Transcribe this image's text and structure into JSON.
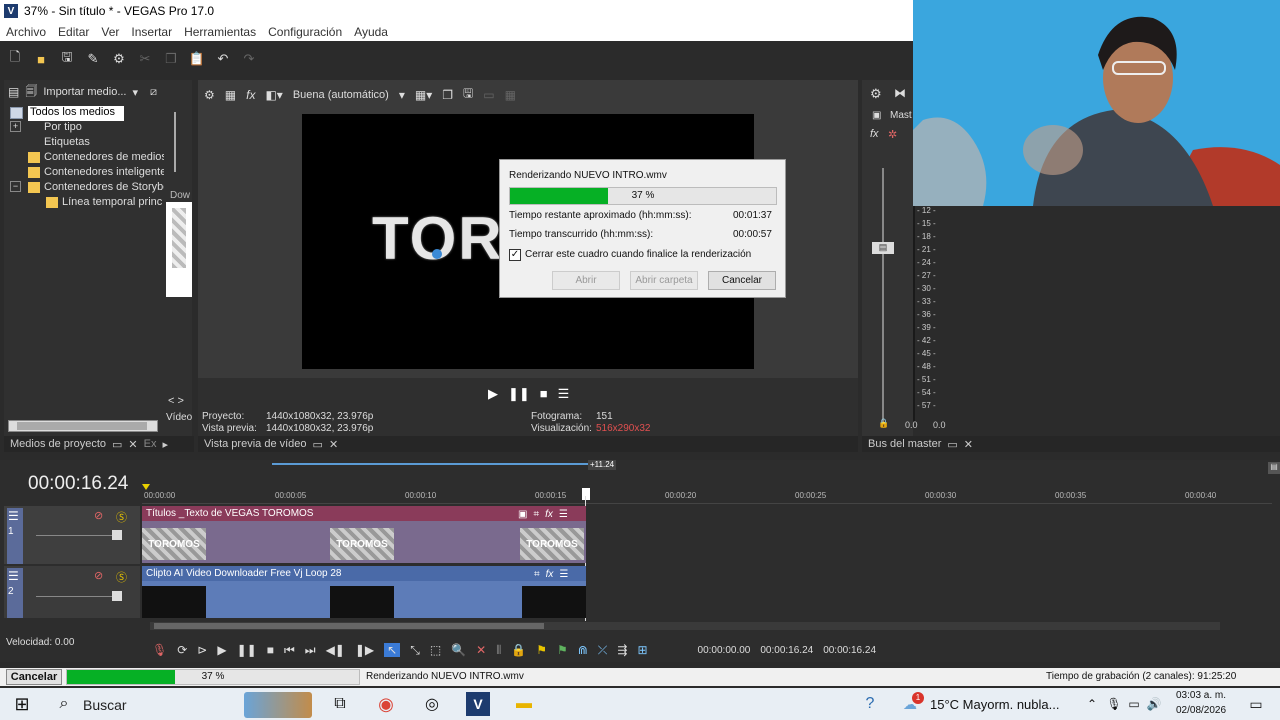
{
  "window": {
    "title": "37% - Sin título * - VEGAS Pro 17.0",
    "app_icon": "V"
  },
  "menu": [
    "Archivo",
    "Editar",
    "Ver",
    "Insertar",
    "Herramientas",
    "Configuración",
    "Ayuda"
  ],
  "media_panel": {
    "import_label": "Importar medio...",
    "tree": [
      "Todos los medios",
      "Por tipo",
      "Etiquetas",
      "Contenedores de medios",
      "Contenedores inteligente",
      "Contenedores de Storybo",
      "Línea temporal princip"
    ],
    "side_label_top": "Dow",
    "side_label_bottom": "Vídeo",
    "tab": "Medios de proyecto",
    "tab2": "Ex"
  },
  "preview": {
    "quality": "Buena (automático)",
    "video_text": "TOR",
    "project_label": "Proyecto:",
    "project_value": "1440x1080x32, 23.976p",
    "preview_label": "Vista previa:",
    "preview_value": "1440x1080x32, 23.976p",
    "frame_label": "Fotograma:",
    "frame_value": "151",
    "display_label": "Visualización:",
    "display_value": "516x290x32",
    "tab": "Vista previa de vídeo"
  },
  "render_dialog": {
    "title": "Renderizando NUEVO INTRO.wmv",
    "progress_text": "37 %",
    "progress": 0.37,
    "remaining_label": "Tiempo restante aproximado (hh:mm:ss):",
    "remaining_value": "00:01:37",
    "elapsed_label": "Tiempo transcurrido (hh:mm:ss):",
    "elapsed_value": "00:00:57",
    "checkbox_label": "Cerrar este cuadro cuando finalice la renderización",
    "open_label": "Abrir",
    "open_folder_label": "Abrir carpeta",
    "cancel_label": "Cancelar"
  },
  "master": {
    "label": "Mast",
    "tab": "Bus del master",
    "meter_labels": [
      "- 12 -",
      "- 15 -",
      "- 18 -",
      "- 21 -",
      "- 24 -",
      "- 27 -",
      "- 30 -",
      "- 33 -",
      "- 36 -",
      "- 39 -",
      "- 42 -",
      "- 45 -",
      "- 48 -",
      "- 51 -",
      "- 54 -",
      "- 57 -"
    ],
    "meter_values": [
      "0.0",
      "0.0"
    ]
  },
  "timeline": {
    "timecode": "00:00:16.24",
    "marker": "+11.24",
    "ruler": [
      "00:00:00",
      "00:00:05",
      "00:00:10",
      "00:00:15",
      "00:00:20",
      "00:00:25",
      "00:00:30",
      "00:00:35",
      "00:00:40"
    ],
    "track1_num": "1",
    "track2_num": "2",
    "track1_clip": "Títulos _Texto de VEGAS TOROMOS",
    "track1_thumb": "TOROMOS",
    "track2_clip": "Clipto AI Video Downloader Free Vj Loop 28",
    "speed": "Velocidad: 0.00",
    "time_start": "00:00:00.00",
    "time_end": "00:00:16.24",
    "time_length": "00:00:16.24"
  },
  "statusbar": {
    "cancel": "Cancelar",
    "progress_text": "37 %",
    "progress": 0.37,
    "rendering": "Renderizando NUEVO INTRO.wmv",
    "record_time": "Tiempo de grabación (2 canales): 91:25:20"
  },
  "taskbar": {
    "search": "Buscar",
    "weather": "15°C  Mayorm. nubla...",
    "badge": "1",
    "time": "03:03 a. m.",
    "date": "02/08/2026"
  }
}
